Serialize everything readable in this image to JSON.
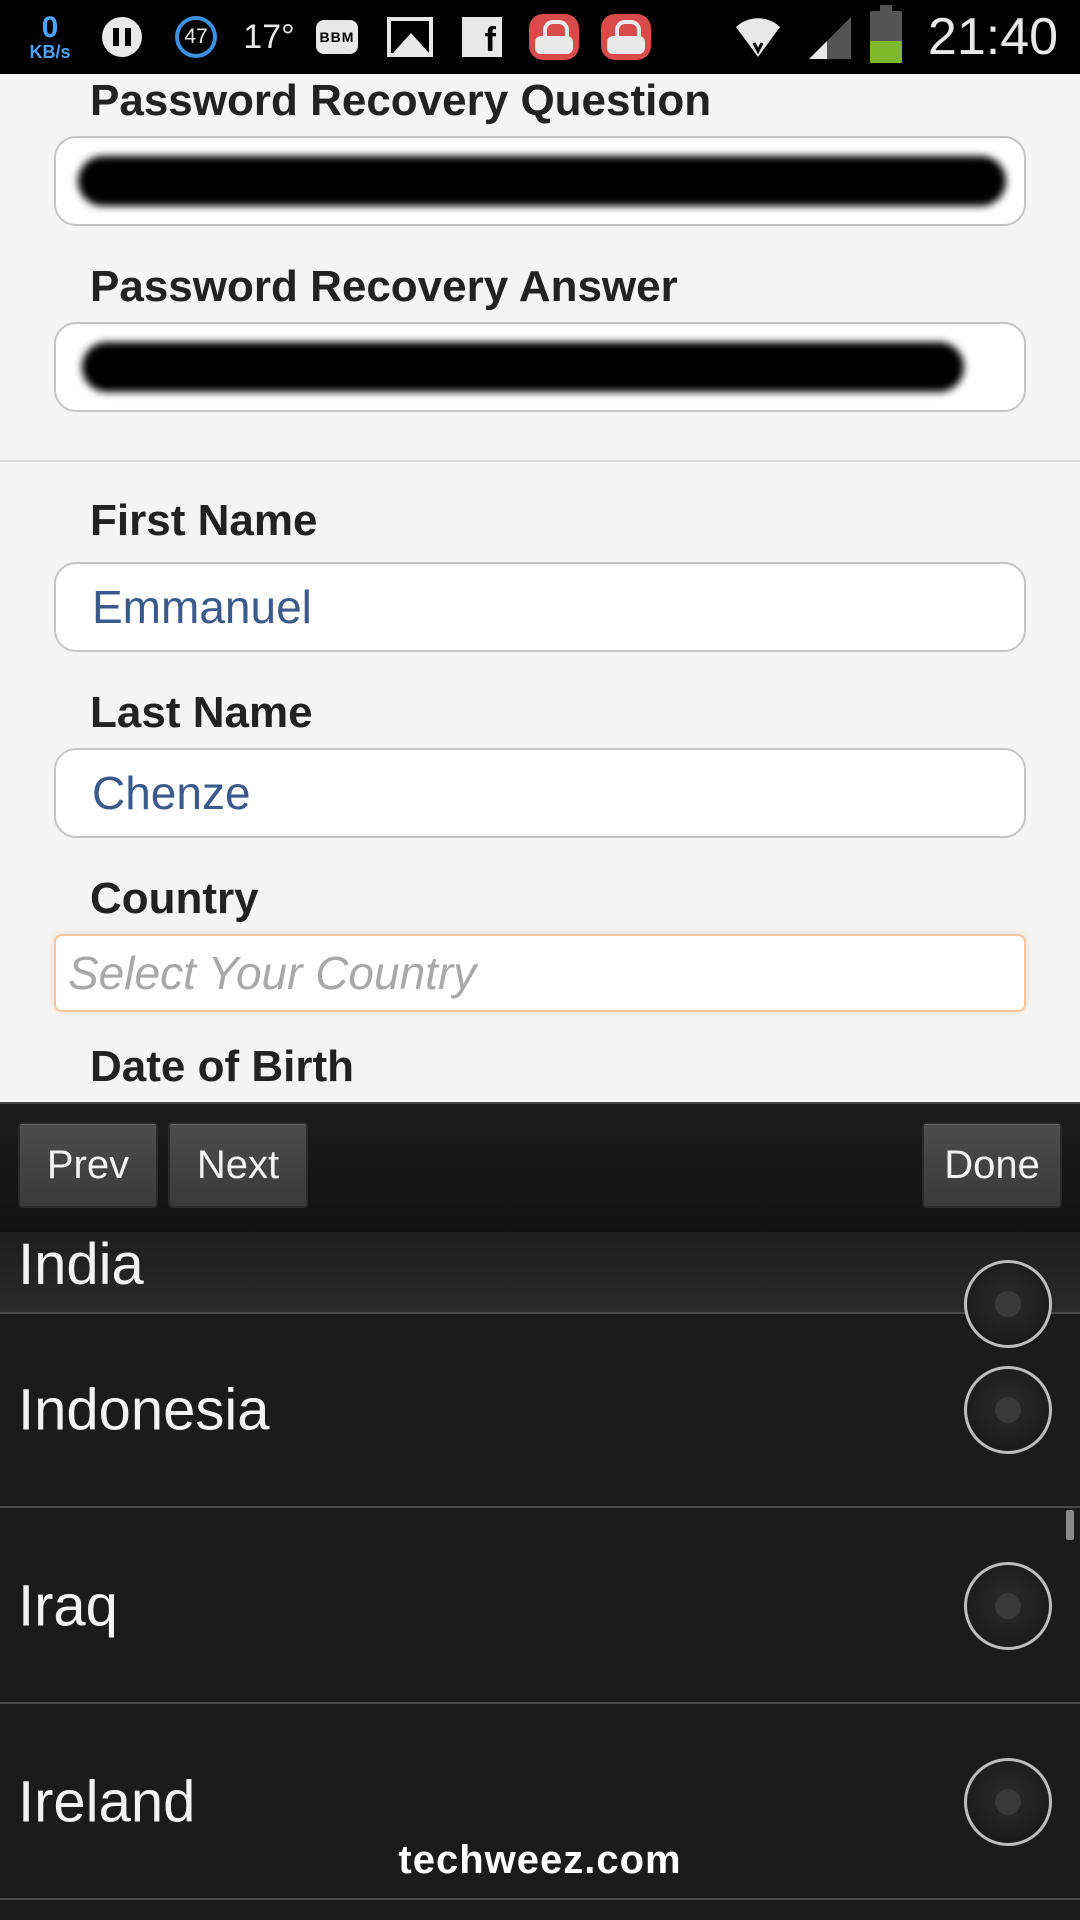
{
  "status_bar": {
    "data_rate_value": "0",
    "data_rate_unit": "KB/s",
    "notification_count": "47",
    "temperature": "17°",
    "bbm_icon_text": "BBM",
    "time": "21:40",
    "battery_level": 0.4,
    "icons": [
      "pause-icon",
      "gallery-icon",
      "facebook-icon",
      "shopping-bag-icon",
      "shopping-bag-icon",
      "wifi-icon",
      "signal-icon",
      "battery-icon"
    ]
  },
  "form": {
    "recovery_question_label": "Password Recovery Question",
    "recovery_answer_label": "Password Recovery Answer",
    "first_name_label": "First Name",
    "first_name_value": "Emmanuel",
    "last_name_label": "Last Name",
    "last_name_value": "Chenze",
    "country_label": "Country",
    "country_placeholder": "Select Your Country",
    "dob_label": "Date of Birth"
  },
  "toolbar": {
    "prev_label": "Prev",
    "next_label": "Next",
    "done_label": "Done"
  },
  "picker": {
    "options": [
      {
        "label": "India",
        "selected": false
      },
      {
        "label": "Indonesia",
        "selected": false
      },
      {
        "label": "Iraq",
        "selected": false
      },
      {
        "label": "Ireland",
        "selected": false
      }
    ]
  },
  "watermark": "techweez.com",
  "colors": {
    "input_text": "#3a5a8c",
    "focus_border": "#f2c79f",
    "battery_fill": "#7db92a",
    "data_rate": "#4fa3ff"
  }
}
